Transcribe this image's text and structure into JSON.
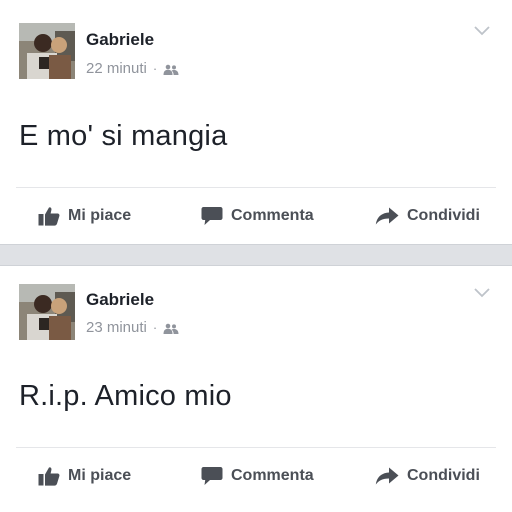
{
  "posts": [
    {
      "author": "Gabriele",
      "time": "22 minuti",
      "separator": "·",
      "privacy_icon": "friends-icon",
      "text": "E mo' si mangia",
      "actions": {
        "like": "Mi piace",
        "comment": "Commenta",
        "share": "Condividi"
      }
    },
    {
      "author": "Gabriele",
      "time": "23 minuti",
      "separator": "·",
      "privacy_icon": "friends-icon",
      "text": "R.i.p. Amico mio",
      "actions": {
        "like": "Mi piace",
        "comment": "Commenta",
        "share": "Condividi"
      }
    }
  ],
  "colors": {
    "name": "#1d2129",
    "meta": "#90949c",
    "action": "#4b4f56",
    "feed_gap": "#dfe1e5"
  }
}
